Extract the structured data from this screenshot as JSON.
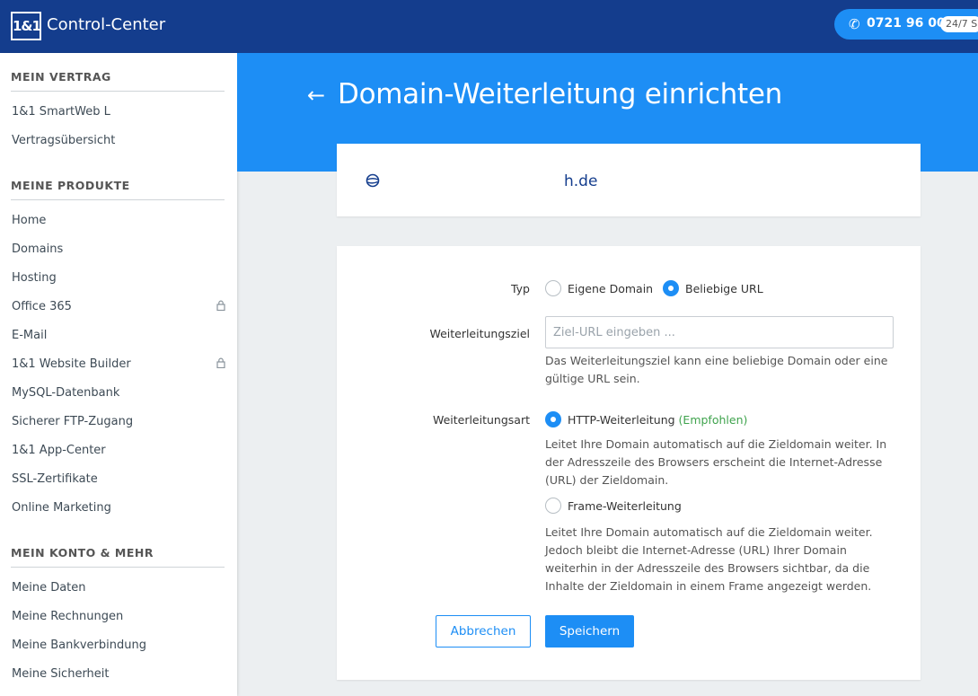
{
  "topbar": {
    "logo": "1&1",
    "title": "Control-Center",
    "hotline_number": "0721 96 00",
    "hotline_badge": "24/7 S"
  },
  "sidebar": {
    "sections": [
      {
        "heading": "MEIN VERTRAG",
        "items": [
          {
            "label": "1&1 SmartWeb L"
          },
          {
            "label": "Vertragsübersicht"
          }
        ]
      },
      {
        "heading": "MEINE PRODUKTE",
        "items": [
          {
            "label": "Home"
          },
          {
            "label": "Domains"
          },
          {
            "label": "Hosting"
          },
          {
            "label": "Office 365",
            "locked": true
          },
          {
            "label": "E-Mail"
          },
          {
            "label": "1&1 Website Builder",
            "locked": true
          },
          {
            "label": "MySQL-Datenbank"
          },
          {
            "label": "Sicherer FTP-Zugang"
          },
          {
            "label": "1&1 App-Center"
          },
          {
            "label": "SSL-Zertifikate"
          },
          {
            "label": "Online Marketing"
          }
        ]
      },
      {
        "heading": "MEIN KONTO & MEHR",
        "items": [
          {
            "label": "Meine Daten"
          },
          {
            "label": "Meine Rechnungen"
          },
          {
            "label": "Meine Bankverbindung"
          },
          {
            "label": "Meine Sicherheit"
          }
        ]
      }
    ]
  },
  "page": {
    "title": "Domain-Weiterleitung einrichten",
    "domain": "h.de"
  },
  "form": {
    "type_label": "Typ",
    "type_options": [
      {
        "label": "Eigene Domain",
        "checked": false
      },
      {
        "label": "Beliebige URL",
        "checked": true
      }
    ],
    "target_label": "Weiterleitungsziel",
    "target_value": "",
    "target_placeholder": "Ziel-URL eingeben ...",
    "target_help": "Das Weiterleitungsziel kann eine beliebige Domain oder eine gültige URL sein.",
    "mode_label": "Weiterleitungsart",
    "mode_options": [
      {
        "label": "HTTP-Weiterleitung",
        "badge": "(Empfohlen)",
        "checked": true,
        "help": "Leitet Ihre Domain automatisch auf die Zieldomain weiter. In der Adresszeile des Browsers erscheint die Internet-Adresse (URL) der Zieldomain."
      },
      {
        "label": "Frame-Weiterleitung",
        "badge": "",
        "checked": false,
        "help": "Leitet Ihre Domain automatisch auf die Zieldomain weiter. Jedoch bleibt die Internet-Adresse (URL) Ihrer Domain weiterhin in der Adresszeile des Browsers sichtbar, da die Inhalte der Zieldomain in einem Frame angezeigt werden."
      }
    ],
    "cancel_label": "Abbrechen",
    "save_label": "Speichern"
  },
  "colors": {
    "topbar": "#143d8d",
    "accent": "#1d8ef5",
    "recommended": "#3fa34d"
  }
}
